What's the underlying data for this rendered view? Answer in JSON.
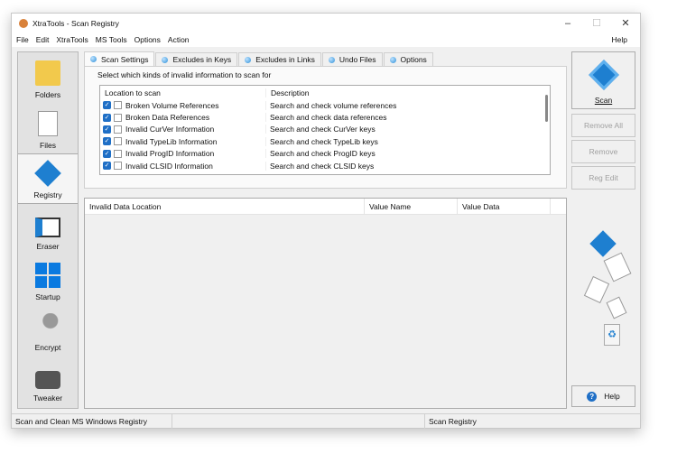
{
  "window": {
    "title": "XtraTools - Scan Registry",
    "min": "–",
    "max": "☐",
    "close": "✕"
  },
  "menu": [
    "File",
    "Edit",
    "XtraTools",
    "MS Tools",
    "Options",
    "Action"
  ],
  "menu_help": "Help",
  "sidebar": [
    {
      "label": "Folders",
      "icon": "folder-icon"
    },
    {
      "label": "Files",
      "icon": "file-icon"
    },
    {
      "label": "Registry",
      "icon": "registry-icon"
    },
    {
      "label": "Eraser",
      "icon": "eraser-icon"
    },
    {
      "label": "Startup",
      "icon": "windows-icon"
    },
    {
      "label": "Encrypt",
      "icon": "key-icon"
    },
    {
      "label": "Tweaker",
      "icon": "tweaker-icon"
    }
  ],
  "tabs": [
    "Scan Settings",
    "Excludes in Keys",
    "Excludes in Links",
    "Undo Files",
    "Options"
  ],
  "group_label": "Select which kinds of invalid information to scan for",
  "scan_list": {
    "headers": [
      "Location to scan",
      "Description"
    ],
    "rows": [
      {
        "name": "Broken Volume References",
        "desc": "Search and check volume references",
        "checked": true
      },
      {
        "name": "Broken Data References",
        "desc": "Search and check data references",
        "checked": true
      },
      {
        "name": "Invalid CurVer Information",
        "desc": "Search and check CurVer keys",
        "checked": true
      },
      {
        "name": "Invalid TypeLib Information",
        "desc": "Search and check TypeLib keys",
        "checked": true
      },
      {
        "name": "Invalid ProgID Information",
        "desc": "Search and check ProgID keys",
        "checked": true
      },
      {
        "name": "Invalid CLSID Information",
        "desc": "Search and check CLSID keys",
        "checked": true
      }
    ]
  },
  "results": {
    "headers": [
      "Invalid Data Location",
      "Value Name",
      "Value Data"
    ]
  },
  "buttons": {
    "scan": "Scan",
    "remove_all": "Remove All",
    "remove": "Remove",
    "reg_edit": "Reg Edit",
    "help": "Help"
  },
  "status": [
    "Scan and Clean MS Windows Registry",
    "",
    "Scan Registry"
  ],
  "colors": {
    "accent": "#1f6fc6"
  }
}
